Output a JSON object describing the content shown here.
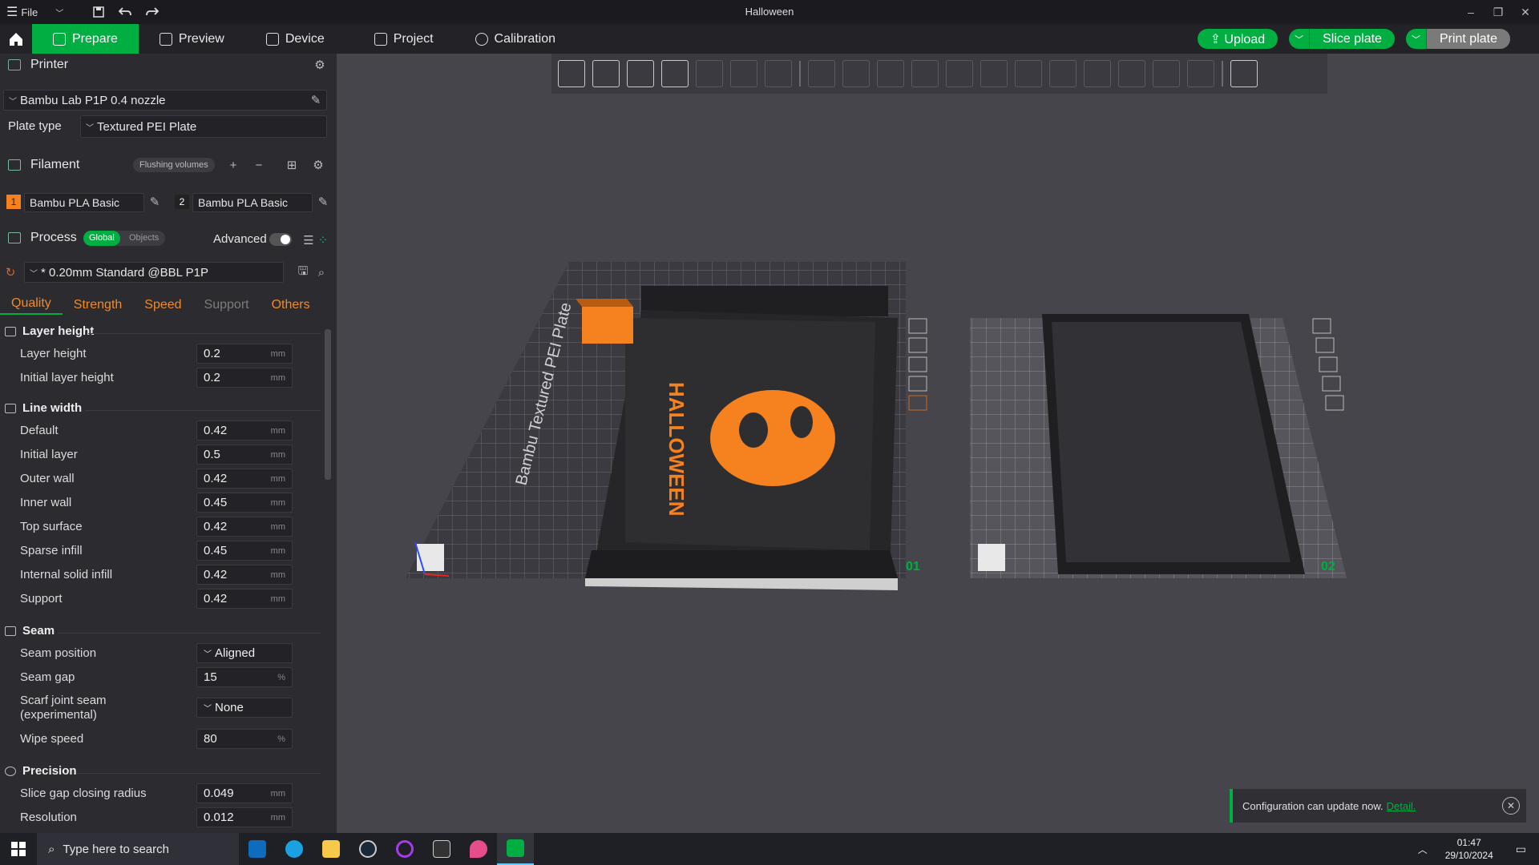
{
  "window": {
    "title": "Halloween",
    "file_menu": "File"
  },
  "tabs": [
    {
      "label": "Prepare",
      "active": true
    },
    {
      "label": "Preview"
    },
    {
      "label": "Device"
    },
    {
      "label": "Project"
    },
    {
      "label": "Calibration"
    }
  ],
  "actions": {
    "upload": "Upload",
    "slice": "Slice plate",
    "print": "Print plate"
  },
  "printer": {
    "header": "Printer",
    "name": "Bambu Lab P1P 0.4 nozzle",
    "plate_type_label": "Plate type",
    "plate_type": "Textured PEI Plate"
  },
  "filament": {
    "header": "Filament",
    "flushing": "Flushing volumes",
    "slots": [
      {
        "num": "1",
        "name": "Bambu PLA Basic",
        "color": "#f5821f"
      },
      {
        "num": "2",
        "name": "Bambu PLA Basic",
        "color": "#222222"
      }
    ]
  },
  "process": {
    "header": "Process",
    "global": "Global",
    "objects": "Objects",
    "advanced": "Advanced",
    "preset": "* 0.20mm Standard @BBL P1P"
  },
  "qtabs": [
    "Quality",
    "Strength",
    "Speed",
    "Support",
    "Others"
  ],
  "sections": [
    {
      "title": "Layer height",
      "rows": [
        {
          "label": "Layer height",
          "value": "0.2",
          "unit": "mm"
        },
        {
          "label": "Initial layer height",
          "value": "0.2",
          "unit": "mm"
        }
      ]
    },
    {
      "title": "Line width",
      "rows": [
        {
          "label": "Default",
          "value": "0.42",
          "unit": "mm"
        },
        {
          "label": "Initial layer",
          "value": "0.5",
          "unit": "mm"
        },
        {
          "label": "Outer wall",
          "value": "0.42",
          "unit": "mm"
        },
        {
          "label": "Inner wall",
          "value": "0.45",
          "unit": "mm"
        },
        {
          "label": "Top surface",
          "value": "0.42",
          "unit": "mm"
        },
        {
          "label": "Sparse infill",
          "value": "0.45",
          "unit": "mm"
        },
        {
          "label": "Internal solid infill",
          "value": "0.42",
          "unit": "mm"
        },
        {
          "label": "Support",
          "value": "0.42",
          "unit": "mm"
        }
      ]
    },
    {
      "title": "Seam",
      "rows": [
        {
          "label": "Seam position",
          "value": "Aligned"
        },
        {
          "label": "Seam gap",
          "value": "15",
          "unit": "%"
        },
        {
          "label": "Scarf joint seam",
          "label2": "(experimental)",
          "value": "None"
        },
        {
          "label": "Wipe speed",
          "value": "80",
          "unit": "%"
        }
      ]
    },
    {
      "title": "Precision",
      "rows": [
        {
          "label": "Slice gap closing radius",
          "value": "0.049",
          "unit": "mm"
        },
        {
          "label": "Resolution",
          "value": "0.012",
          "unit": "mm"
        }
      ]
    }
  ],
  "scene": {
    "plate1": "01",
    "plate2": "02",
    "model_text": "HALLOWEEN",
    "bed_text": "Bambu Textured PEI Plate"
  },
  "notification": {
    "text": "Configuration can update now.",
    "link": "Detail."
  },
  "taskbar": {
    "search_placeholder": "Type here to search",
    "time": "01:47",
    "date": "29/10/2024"
  }
}
